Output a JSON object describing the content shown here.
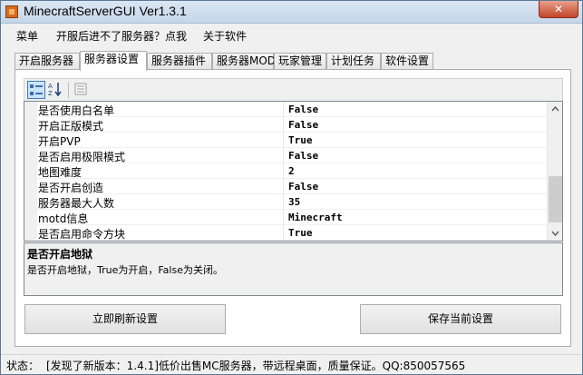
{
  "window": {
    "title": "MinecraftServerGUI Ver1.3.1",
    "close_label": "✕"
  },
  "menu": [
    {
      "label": "菜单"
    },
    {
      "label": "开服后进不了服务器？点我"
    },
    {
      "label": "关于软件"
    }
  ],
  "tabs": [
    {
      "label": "开启服务器"
    },
    {
      "label": "服务器设置",
      "active": true
    },
    {
      "label": "服务器插件"
    },
    {
      "label": "服务器MOD"
    },
    {
      "label": "玩家管理"
    },
    {
      "label": "计划任务"
    },
    {
      "label": "软件设置"
    }
  ],
  "properties": [
    {
      "name": "是否使用白名单",
      "value": "False"
    },
    {
      "name": "开启正版模式",
      "value": "False"
    },
    {
      "name": "开启PVP",
      "value": "True"
    },
    {
      "name": "是否启用极限模式",
      "value": "False"
    },
    {
      "name": "地图难度",
      "value": "2"
    },
    {
      "name": "是否开启创造",
      "value": "False"
    },
    {
      "name": "服务器最大人数",
      "value": "35"
    },
    {
      "name": "motd信息",
      "value": "Minecraft"
    },
    {
      "name": "是否启用命令方块",
      "value": "True"
    }
  ],
  "help": {
    "title": "是否开启地狱",
    "description": "是否开启地狱，True为开启，False为关闭。"
  },
  "buttons": {
    "refresh": "立即刷新设置",
    "save": "保存当前设置"
  },
  "status": {
    "label": "状态：",
    "text": "[发现了新版本：1.4.1]低价出售MC服务器，带远程桌面，质量保证。QQ:850057565"
  },
  "colors": {
    "selected_tool": "#cce4f7",
    "app_icon": "#d96a1f",
    "close_button": "#c4452a"
  }
}
